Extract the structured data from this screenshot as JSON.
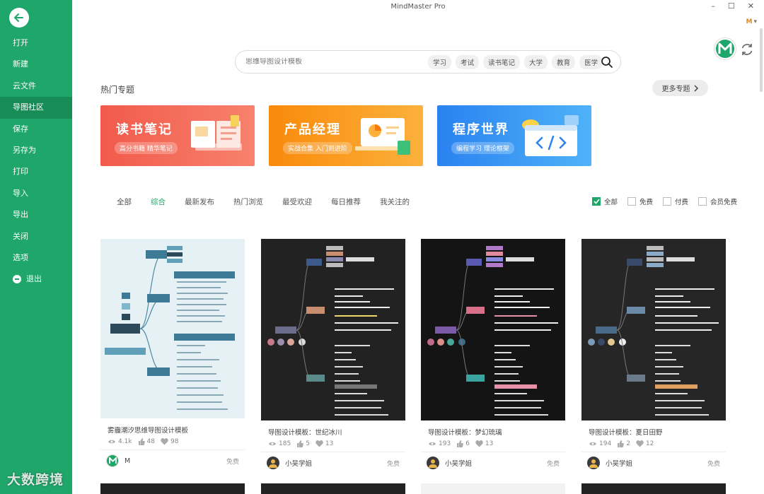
{
  "app": {
    "title": "MindMaster Pro",
    "user_initial": "M"
  },
  "window": {
    "minimize": "–",
    "maximize": "☐",
    "close": "✕"
  },
  "sidebar": {
    "items": [
      {
        "label": "打开"
      },
      {
        "label": "新建"
      },
      {
        "label": "云文件"
      },
      {
        "label": "导图社区",
        "active": true
      },
      {
        "label": "保存"
      },
      {
        "label": "另存为"
      },
      {
        "label": "打印"
      },
      {
        "label": "导入"
      },
      {
        "label": "导出"
      },
      {
        "label": "关闭"
      },
      {
        "label": "选项"
      },
      {
        "label": "退出"
      }
    ]
  },
  "search": {
    "placeholder": "思维导图设计模板",
    "tags": [
      "学习",
      "考试",
      "读书笔记",
      "大学",
      "教育",
      "医学"
    ]
  },
  "hot": {
    "title": "热门专题",
    "more_label": "更多专题",
    "banners": [
      {
        "title": "读书笔记",
        "subtitle": "高分书籍 精华笔记"
      },
      {
        "title": "产品经理",
        "subtitle": "实战合集 入门到进阶"
      },
      {
        "title": "程序世界",
        "subtitle": "编程学习 理论框架"
      }
    ]
  },
  "filters": {
    "tabs": [
      "全部",
      "综合",
      "最新发布",
      "热门浏览",
      "最受欢迎",
      "每日推荐",
      "我关注的"
    ],
    "active_tab": 1,
    "checks": [
      {
        "label": "全部",
        "checked": true
      },
      {
        "label": "免费",
        "checked": false
      },
      {
        "label": "付费",
        "checked": false
      },
      {
        "label": "会员免费",
        "checked": false
      }
    ]
  },
  "cards": [
    {
      "title": "雾霾潮汐思维导图设计模板",
      "views": "4.1k",
      "likes": "48",
      "favs": "98",
      "author": "M",
      "price": "免费"
    },
    {
      "title": "导图设计模板：世纪冰川",
      "views": "185",
      "likes": "5",
      "favs": "13",
      "author": "小吴学姐",
      "price": "免费"
    },
    {
      "title": "导图设计模板：梦幻琉璃",
      "views": "193",
      "likes": "6",
      "favs": "13",
      "author": "小吴学姐",
      "price": "免费"
    },
    {
      "title": "导图设计模板：夏日田野",
      "views": "194",
      "likes": "2",
      "favs": "12",
      "author": "小吴学姐",
      "price": "免费"
    }
  ],
  "watermark": "大数跨境",
  "colors": {
    "brand": "#1fa66a",
    "accent_banner1": "#f25a4b",
    "accent_banner2": "#f98a0c",
    "accent_banner3": "#2a82f0"
  }
}
